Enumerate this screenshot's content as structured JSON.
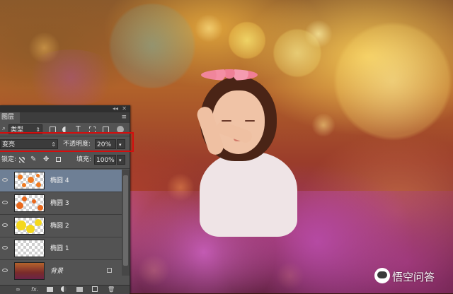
{
  "panel": {
    "tab_label": "图层",
    "filter_kind": "类型",
    "filter_icons": [
      "pixel-filter-icon",
      "adjustment-filter-icon",
      "type-filter-icon",
      "shape-filter-icon",
      "smart-object-filter-icon"
    ],
    "blend_mode": "变亮",
    "opacity_label": "不透明度:",
    "opacity_value": "20%",
    "lock_label": "锁定:",
    "fill_label": "填充:",
    "fill_value": "100%",
    "layers": [
      {
        "name": "椭圆 4",
        "selected": true,
        "visible": true
      },
      {
        "name": "椭圆 3",
        "selected": false,
        "visible": true
      },
      {
        "name": "椭圆 2",
        "selected": false,
        "visible": true
      },
      {
        "name": "椭圆 1",
        "selected": false,
        "visible": true
      },
      {
        "name": "背景",
        "selected": false,
        "visible": true,
        "locked": true
      }
    ],
    "bottom_icons": [
      "link-icon",
      "fx-icon",
      "mask-icon",
      "adjustment-icon",
      "group-icon",
      "new-layer-icon",
      "delete-icon"
    ],
    "bottom_fx_label": "fx."
  },
  "colors": {
    "highlight_box": "#d40d0d",
    "selected_layer": "#6e7f95",
    "panel_bg": "#535353"
  },
  "watermark": {
    "text": "悟空问答"
  }
}
